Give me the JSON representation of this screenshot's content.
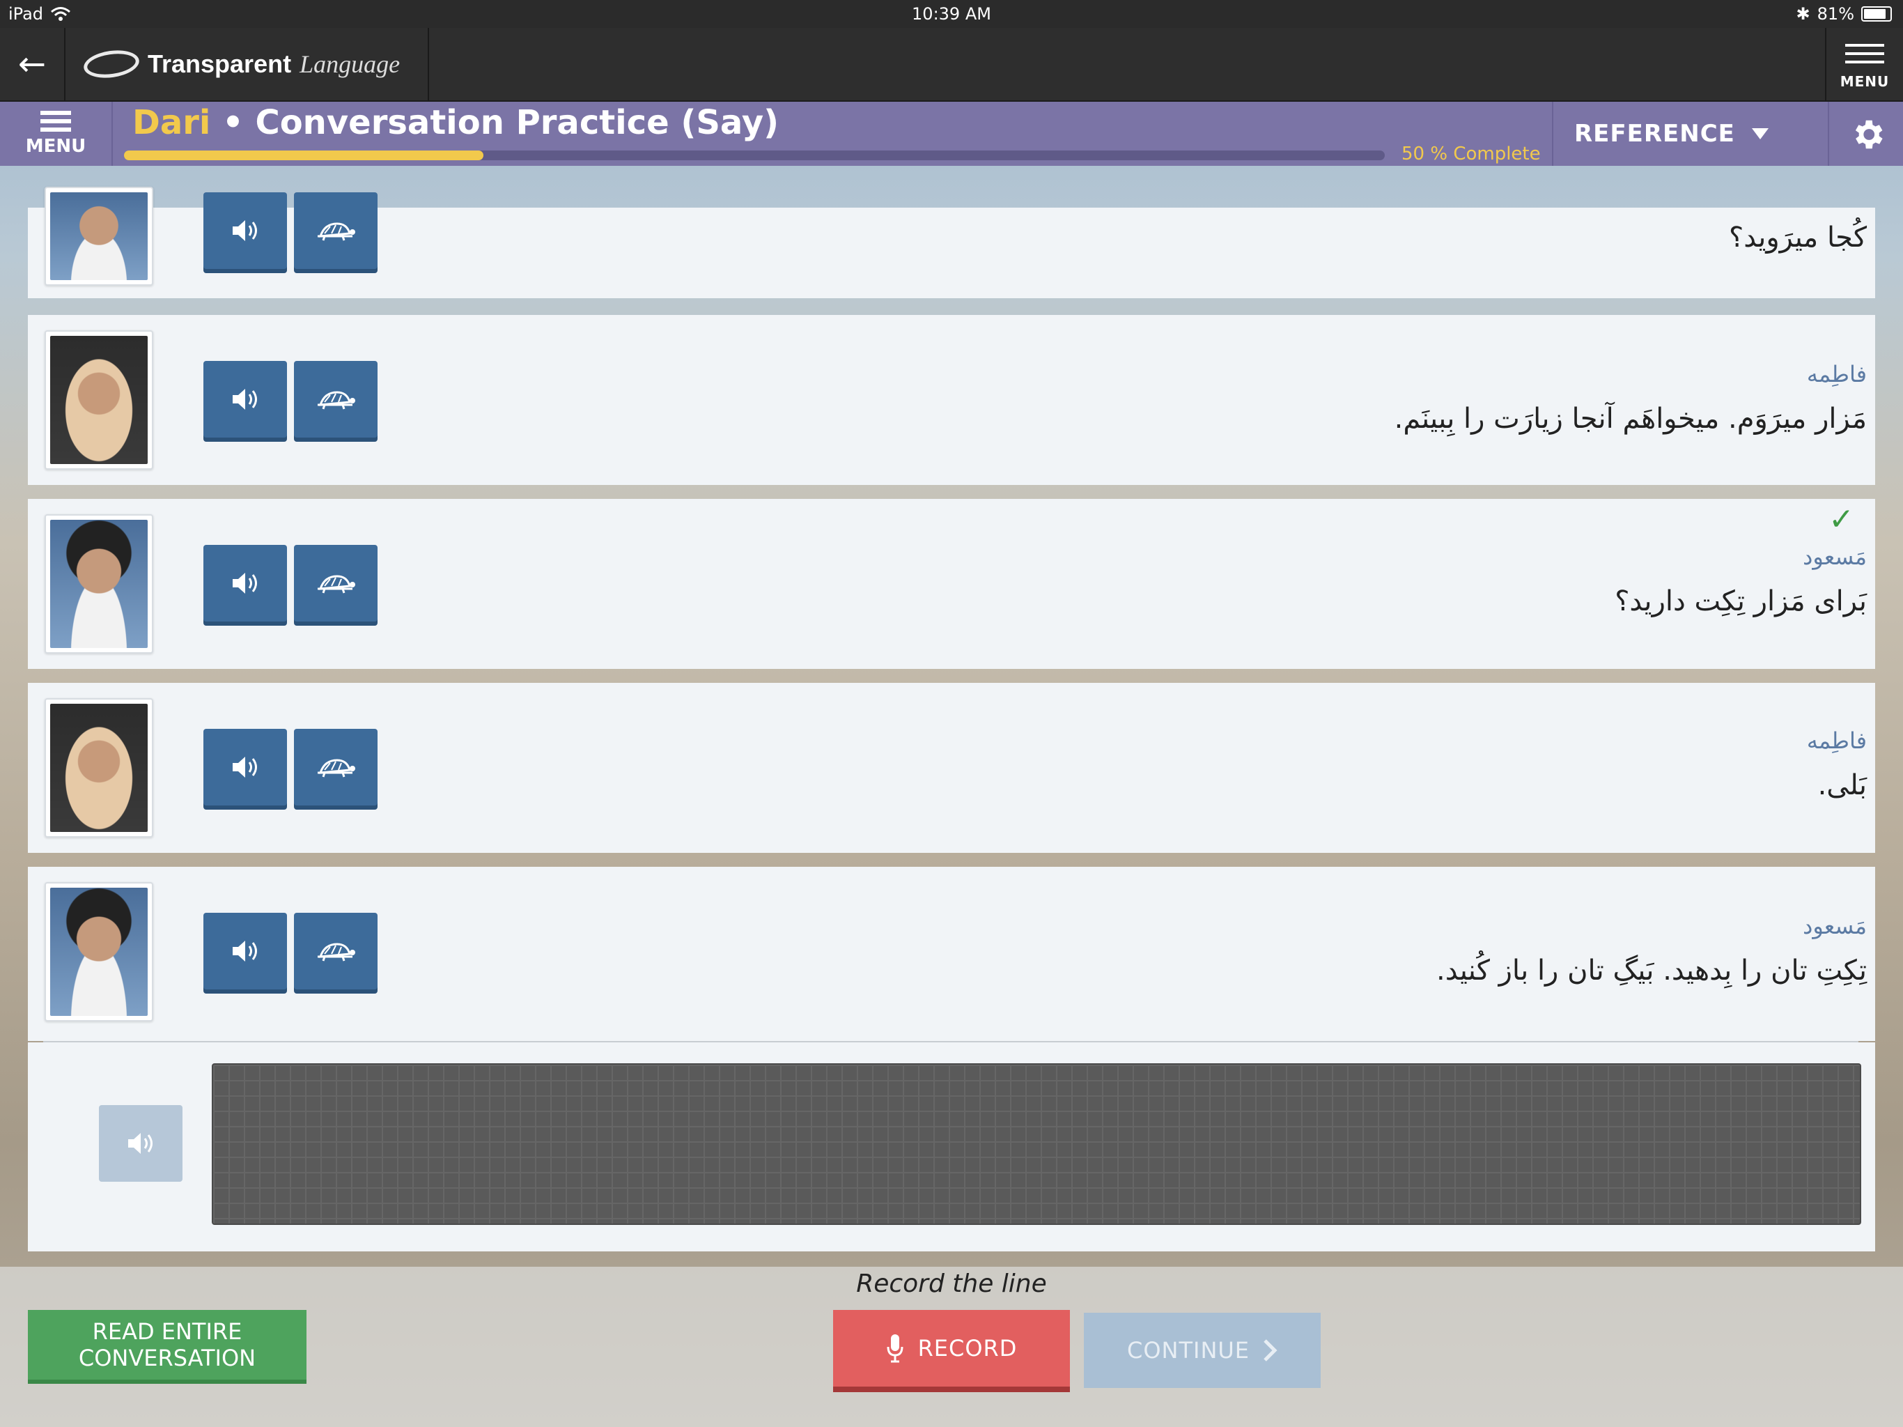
{
  "status_bar": {
    "device": "iPad",
    "time": "10:39 AM",
    "battery": "81%"
  },
  "app": {
    "brand_bold": "Transparent",
    "brand_italic": "Language",
    "menu_label": "MENU"
  },
  "lesson": {
    "menu_label": "MENU",
    "language": "Dari",
    "separator": " • ",
    "activity": "Conversation Practice (Say)",
    "progress_percent": 50,
    "progress_text": "50 % Complete",
    "reference_label": "REFERENCE"
  },
  "rows": [
    {
      "speaker": "",
      "line": "کُجا میرَوید؟",
      "done": false
    },
    {
      "speaker": "فاطِمه",
      "line": "مَزار میرَوَم. میخواهَم آنجا زیارَت را بِبینَم.",
      "done": false
    },
    {
      "speaker": "مَسعود",
      "line": "بَرای مَزار تِکِت دارید؟",
      "done": true,
      "check": "✓"
    },
    {
      "speaker": "فاطِمه",
      "line": "بَلی.",
      "done": false
    },
    {
      "speaker": "مَسعود",
      "line": "تِکِتِ تان را بِدهید. بَیگِ تان را باز کُنید.",
      "done": false
    }
  ],
  "bottom": {
    "instruction": "Record the line",
    "read_entire": "READ ENTIRE\nCONVERSATION",
    "record": "RECORD",
    "continue": "CONTINUE"
  },
  "colors": {
    "accent_purple": "#7b74a6",
    "progress": "#f2c94c",
    "button_blue": "#3d6b9a",
    "record_red": "#e25f5f",
    "read_green": "#4ea35d"
  }
}
